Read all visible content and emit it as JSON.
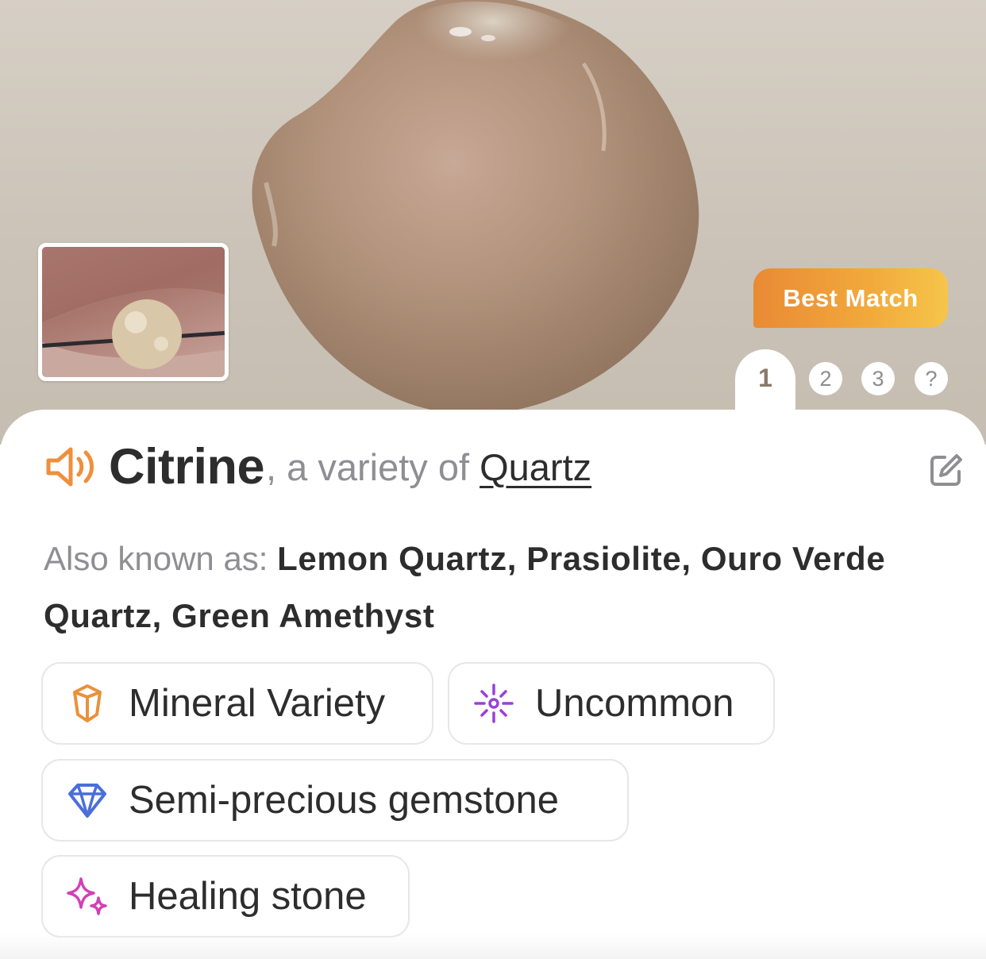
{
  "hero": {
    "badge_label": "Best Match",
    "pager": [
      "1",
      "2",
      "3",
      "?"
    ],
    "active_page": "1"
  },
  "result": {
    "name": "Citrine",
    "variety_prefix": ", a variety of ",
    "variety_link": "Quartz",
    "aka_label": "Also known as: ",
    "aka_values": "Lemon Quartz, Prasiolite, Ouro Verde Quartz, Green Amethyst"
  },
  "tags": [
    {
      "label": "Mineral Variety",
      "icon": "crystal-icon",
      "color": "#e9913b"
    },
    {
      "label": "Uncommon",
      "icon": "sparkle-burst-icon",
      "color": "#9b3fd6"
    },
    {
      "label": "Semi-precious gemstone",
      "icon": "diamond-icon",
      "color": "#4b6fd8"
    },
    {
      "label": "Healing stone",
      "icon": "sparkles-icon",
      "color": "#d43fb6"
    }
  ],
  "colors": {
    "accent_orange": "#ef8f3c",
    "badge_gradient_end": "#f6c54a",
    "muted_text": "#8e8e93"
  }
}
